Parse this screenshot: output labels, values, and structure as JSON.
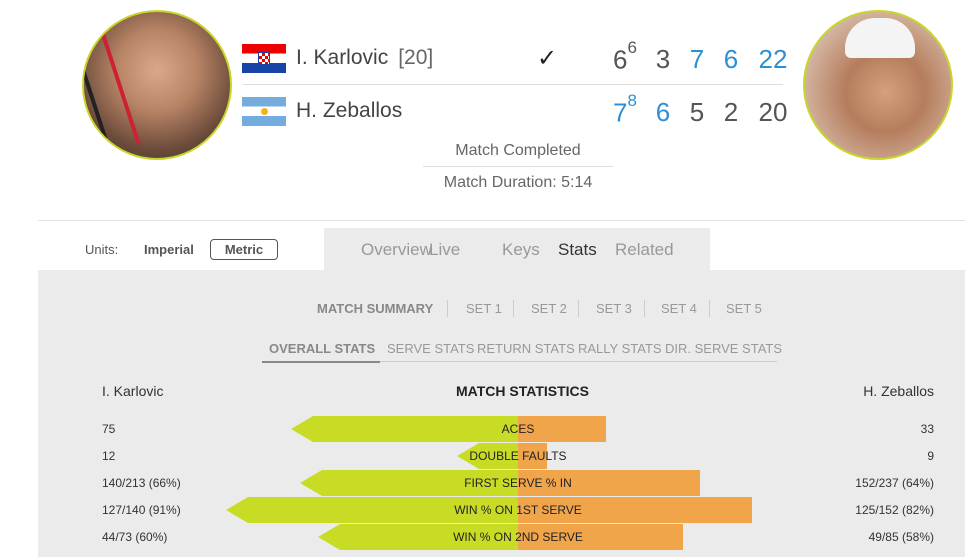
{
  "match": {
    "player1": {
      "name": "I. Karlovic",
      "seed": "[20]",
      "winner_mark": "✓",
      "sets": [
        {
          "v": "6",
          "tb": "6",
          "win": false
        },
        {
          "v": "3",
          "win": false
        },
        {
          "v": "7",
          "win": true
        },
        {
          "v": "6",
          "win": true
        },
        {
          "v": "22",
          "win": true
        }
      ]
    },
    "player2": {
      "name": "H. Zeballos",
      "sets": [
        {
          "v": "7",
          "tb": "8",
          "win": true
        },
        {
          "v": "6",
          "win": true
        },
        {
          "v": "5",
          "win": false
        },
        {
          "v": "2",
          "win": false
        },
        {
          "v": "20",
          "win": false
        }
      ]
    },
    "status": "Match Completed",
    "duration": "Match Duration: 5:14"
  },
  "units": {
    "label": "Units:",
    "imperial": "Imperial",
    "metric": "Metric"
  },
  "nav_tabs": [
    "Overview",
    "Live",
    "Keys",
    "Stats",
    "Related"
  ],
  "active_nav_tab": "Stats",
  "set_tabs": [
    "MATCH SUMMARY",
    "SET 1",
    "SET 2",
    "SET 3",
    "SET 4",
    "SET 5"
  ],
  "stat_tabs": [
    "OVERALL STATS",
    "SERVE STATS",
    "RETURN STATS",
    "RALLY STATS",
    "DIR. SERVE STATS"
  ],
  "stats_header": {
    "left": "I. Karlovic",
    "center": "MATCH STATISTICS",
    "right": "H. Zeballos"
  },
  "stats": [
    {
      "label": "ACES",
      "left": "75",
      "right": "33",
      "left_frac": 0.69,
      "right_frac": 0.31
    },
    {
      "label": "DOUBLE FAULTS",
      "left": "12",
      "right": "9",
      "left_frac": 0.13,
      "right_frac": 0.1
    },
    {
      "label": "FIRST SERVE % IN",
      "left": "140/213 (66%)",
      "right": "152/237 (64%)",
      "left_frac": 0.66,
      "right_frac": 0.64
    },
    {
      "label": "WIN % ON 1ST SERVE",
      "left": "127/140 (91%)",
      "right": "125/152 (82%)",
      "left_frac": 0.91,
      "right_frac": 0.82
    },
    {
      "label": "WIN % ON 2ND SERVE",
      "left": "44/73 (60%)",
      "right": "49/85 (58%)",
      "left_frac": 0.6,
      "right_frac": 0.58
    }
  ],
  "colors": {
    "accent_blue": "#2f8fd4",
    "left_bar": "#c8dc26",
    "right_bar": "#f0a54b"
  }
}
